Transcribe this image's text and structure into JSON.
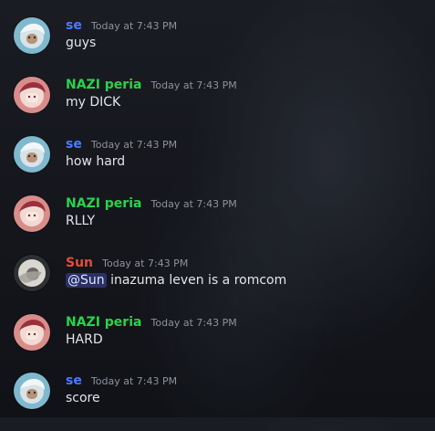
{
  "colors": {
    "se": "#4a7bff",
    "nazi": "#2bd24b",
    "sun": "#e64c39",
    "timestamp": "#8e9297",
    "text": "#e3e5e8"
  },
  "messages": [
    {
      "user": "se",
      "time": "Today at 7:43 PM",
      "text": "guys",
      "color": "#4a7bff",
      "avatar": "se-avatar"
    },
    {
      "user": "NAZI peria",
      "time": "Today at 7:43 PM",
      "text": "my DICK",
      "color": "#2bd24b",
      "avatar": "nazi-avatar"
    },
    {
      "user": "se",
      "time": "Today at 7:43 PM",
      "text": "how hard",
      "color": "#4a7bff",
      "avatar": "se-avatar"
    },
    {
      "user": "NAZI peria",
      "time": "Today at 7:43 PM",
      "text": "RLLY",
      "color": "#2bd24b",
      "avatar": "nazi-avatar"
    },
    {
      "user": "Sun",
      "time": "Today at 7:43 PM",
      "mention": "@Sun",
      "text": "inazuma leven is a romcom",
      "color": "#e64c39",
      "avatar": "sun-avatar"
    },
    {
      "user": "NAZI peria",
      "time": "Today at 7:43 PM",
      "text": "HARD",
      "color": "#2bd24b",
      "avatar": "nazi-avatar"
    },
    {
      "user": "se",
      "time": "Today at 7:43 PM",
      "text": "score",
      "color": "#4a7bff",
      "avatar": "se-avatar"
    }
  ]
}
